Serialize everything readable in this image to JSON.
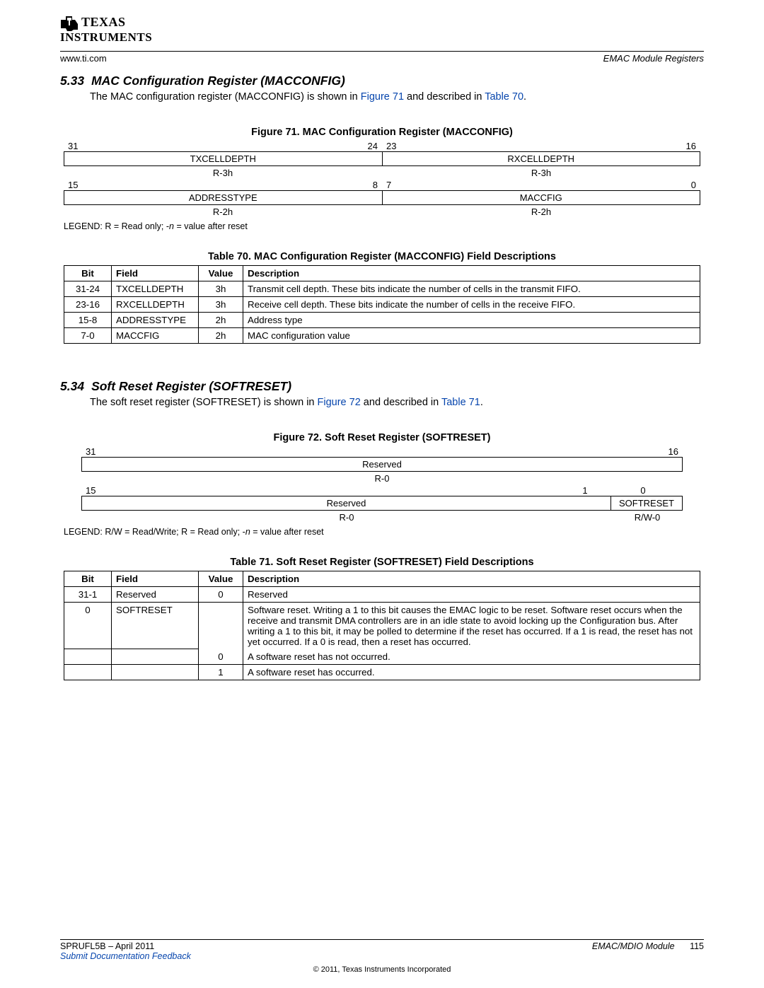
{
  "header": {
    "url": "www.ti.com",
    "section": "EMAC Module Registers"
  },
  "sec533": {
    "num": "5.33",
    "title": "MAC Configuration Register (MACCONFIG)",
    "text_a": "The MAC configuration register (MACCONFIG) is shown in ",
    "link1": "Figure 71",
    "text_b": " and described in ",
    "link2": "Table 70",
    "text_c": "."
  },
  "fig71": {
    "caption": "Figure 71. MAC Configuration Register (MACCONFIG)",
    "bits": {
      "b31": "31",
      "b24": "24",
      "b23": "23",
      "b16": "16",
      "b15": "15",
      "b8": "8",
      "b7": "7",
      "b0": "0"
    },
    "row1": {
      "f1": "TXCELLDEPTH",
      "f2": "RXCELLDEPTH"
    },
    "row1r": {
      "f1": "R-3h",
      "f2": "R-3h"
    },
    "row2": {
      "f1": "ADDRESSTYPE",
      "f2": "MACCFIG"
    },
    "row2r": {
      "f1": "R-2h",
      "f2": "R-2h"
    },
    "legend": "LEGEND: R = Read only; -n = value after reset"
  },
  "tbl70": {
    "caption": "Table 70. MAC Configuration Register (MACCONFIG) Field Descriptions",
    "headers": {
      "bit": "Bit",
      "field": "Field",
      "value": "Value",
      "desc": "Description"
    },
    "rows": [
      {
        "bit": "31-24",
        "field": "TXCELLDEPTH",
        "value": "3h",
        "desc": "Transmit cell depth. These bits indicate the number of cells in the transmit FIFO."
      },
      {
        "bit": "23-16",
        "field": "RXCELLDEPTH",
        "value": "3h",
        "desc": "Receive cell depth. These bits indicate the number of cells in the receive FIFO."
      },
      {
        "bit": "15-8",
        "field": "ADDRESSTYPE",
        "value": "2h",
        "desc": "Address type"
      },
      {
        "bit": "7-0",
        "field": "MACCFIG",
        "value": "2h",
        "desc": "MAC configuration value"
      }
    ]
  },
  "sec534": {
    "num": "5.34",
    "title": "Soft Reset Register (SOFTRESET)",
    "text_a": "The soft reset register (SOFTRESET) is shown in ",
    "link1": "Figure 72",
    "text_b": " and described in ",
    "link2": "Table 71",
    "text_c": "."
  },
  "fig72": {
    "caption": "Figure 72. Soft Reset Register (SOFTRESET)",
    "bits": {
      "b31": "31",
      "b16": "16",
      "b15": "15",
      "b1": "1",
      "b0": "0"
    },
    "row1": {
      "f1": "Reserved"
    },
    "row1r": {
      "f1": "R-0"
    },
    "row2": {
      "f1": "Reserved",
      "f2": "SOFTRESET"
    },
    "row2r": {
      "f1": "R-0",
      "f2": "R/W-0"
    },
    "legend": "LEGEND: R/W = Read/Write; R = Read only; -n = value after reset"
  },
  "tbl71": {
    "caption": "Table 71. Soft Reset Register (SOFTRESET) Field Descriptions",
    "headers": {
      "bit": "Bit",
      "field": "Field",
      "value": "Value",
      "desc": "Description"
    },
    "rows": [
      {
        "bit": "31-1",
        "field": "Reserved",
        "value": "0",
        "desc": "Reserved"
      },
      {
        "bit": "0",
        "field": "SOFTRESET",
        "value": "",
        "desc": "Software reset. Writing a 1 to this bit causes the EMAC logic to be reset. Software reset occurs when the receive and transmit DMA controllers are in an idle state to avoid locking up the Configuration bus. After writing a 1 to this bit, it may be polled to determine if the reset has occurred. If a 1 is read, the reset has not yet occurred. If a 0 is read, then a reset has occurred."
      },
      {
        "bit": "",
        "field": "",
        "value": "0",
        "desc": "A software reset has not occurred."
      },
      {
        "bit": "",
        "field": "",
        "value": "1",
        "desc": "A software reset has occurred."
      }
    ]
  },
  "footer": {
    "docid": "SPRUFL5B – April 2011",
    "feedback": "Submit Documentation Feedback",
    "module": "EMAC/MDIO Module",
    "page": "115",
    "copyright": "© 2011, Texas Instruments Incorporated"
  }
}
